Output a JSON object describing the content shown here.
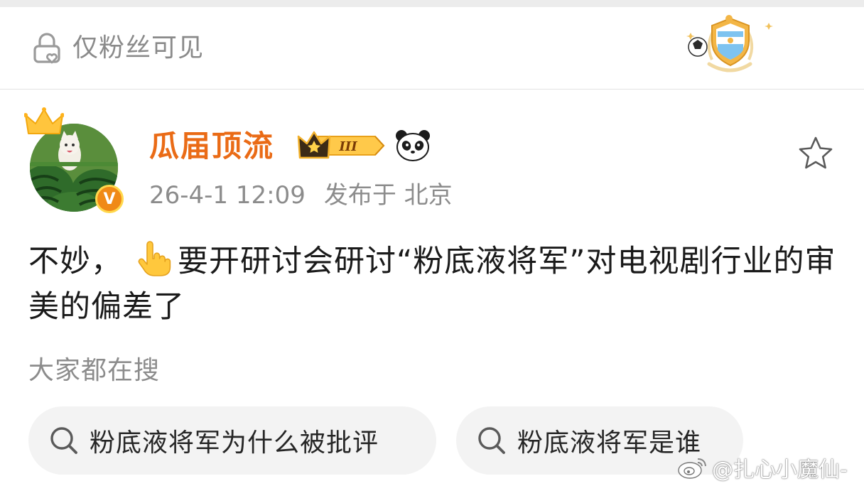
{
  "header": {
    "visibility_label": "仅粉丝可见"
  },
  "author": {
    "name": "瓜届顶流",
    "member_level": "III",
    "verified_mark": "V",
    "posted_at": "26-4-1 12:09",
    "location": "发布于 北京"
  },
  "post": {
    "text_before_icon": "不妙，",
    "text_after_icon": "要开研讨会研讨“粉底液将军”对电视剧行业的审美的偏差了"
  },
  "search": {
    "title": "大家都在搜",
    "suggestions": [
      {
        "label": "粉底液将军为什么被批评"
      },
      {
        "label": "粉底液将军是谁"
      }
    ]
  },
  "watermark": {
    "handle": "@扎心小魔仙-"
  },
  "colors": {
    "username": "#ea6b16",
    "verified": "#f08a17",
    "muted_text": "#8c8c8c",
    "chip_bg": "#f3f3f3"
  },
  "icons": {
    "visibility": "lock-heart-icon",
    "badge": "argentina-shield-badge-icon",
    "crown": "crown-icon",
    "member": "crown-member-badge-icon",
    "panda": "panda-icon",
    "favorite": "star-outline-icon",
    "pointing": "pointing-up-hand-icon",
    "search": "search-icon",
    "weibo": "weibo-logo-icon"
  }
}
